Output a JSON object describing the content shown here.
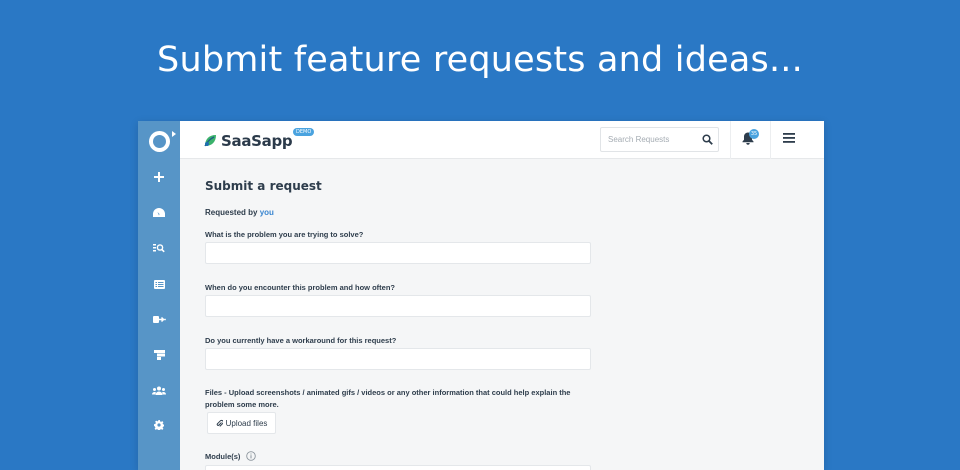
{
  "headline": "Submit feature requests and ideas...",
  "brand": {
    "name": "SaaSapp",
    "badge": "DEMO"
  },
  "search": {
    "placeholder": "Search Requests"
  },
  "notifications": {
    "count": "35"
  },
  "sidebar": {
    "items": [
      {
        "icon": "plus-icon"
      },
      {
        "icon": "dashboard-icon"
      },
      {
        "icon": "search-list-icon"
      },
      {
        "icon": "list-icon"
      },
      {
        "icon": "export-icon"
      },
      {
        "icon": "roadmap-icon"
      },
      {
        "icon": "users-icon"
      },
      {
        "icon": "gear-icon"
      }
    ]
  },
  "form": {
    "title": "Submit a request",
    "requested_by_label": "Requested by",
    "requested_by_user": "you",
    "q1": "What is the problem you are trying to solve?",
    "q2": "When do you encounter this problem and how often?",
    "q3": "Do you currently have a workaround for this request?",
    "files_label": "Files - Upload screenshots / animated gifs / videos or any other information that could help explain the problem some more.",
    "upload_button": "Upload files",
    "modules_label": "Module(s)"
  },
  "colors": {
    "background": "#2a78c5",
    "sidebar": "#5795c7",
    "accent": "#4aa3df",
    "text": "#2e3d4c"
  }
}
